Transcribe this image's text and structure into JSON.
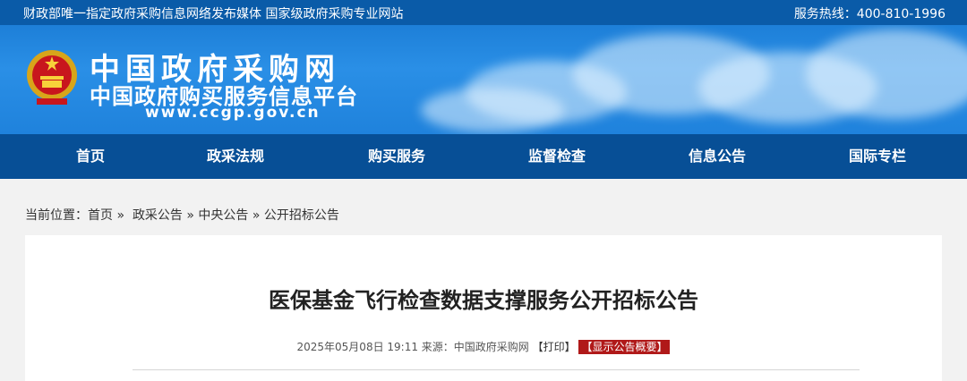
{
  "topbar": {
    "left_text": "财政部唯一指定政府采购信息网络发布媒体 国家级政府采购专业网站",
    "hotline": "服务热线：400-810-1996"
  },
  "banner": {
    "site_name": "中国政府采购网",
    "site_subtitle": "中国政府购买服务信息平台",
    "site_url": "www.ccgp.gov.cn",
    "emblem_icon": "national-emblem-icon"
  },
  "nav": {
    "items": [
      {
        "label": "首页"
      },
      {
        "label": "政采法规"
      },
      {
        "label": "购买服务"
      },
      {
        "label": "监督检查"
      },
      {
        "label": "信息公告"
      },
      {
        "label": "国际专栏"
      }
    ]
  },
  "breadcrumb": {
    "prefix": "当前位置：",
    "items": [
      "首页",
      "政采公告",
      "中央公告",
      "公开招标公告"
    ],
    "separator": "»"
  },
  "article": {
    "title": "医保基金飞行检查数据支撑服务公开招标公告",
    "meta_date": "2025年05月08日 19:11 来源：中国政府采购网",
    "print_label": "【打印】",
    "summary_label": "【显示公告概要】"
  },
  "colors": {
    "topbar": "#0a5ba8",
    "banner": "#1d7fd8",
    "nav": "#074f96",
    "summary_badge": "#b01919"
  }
}
